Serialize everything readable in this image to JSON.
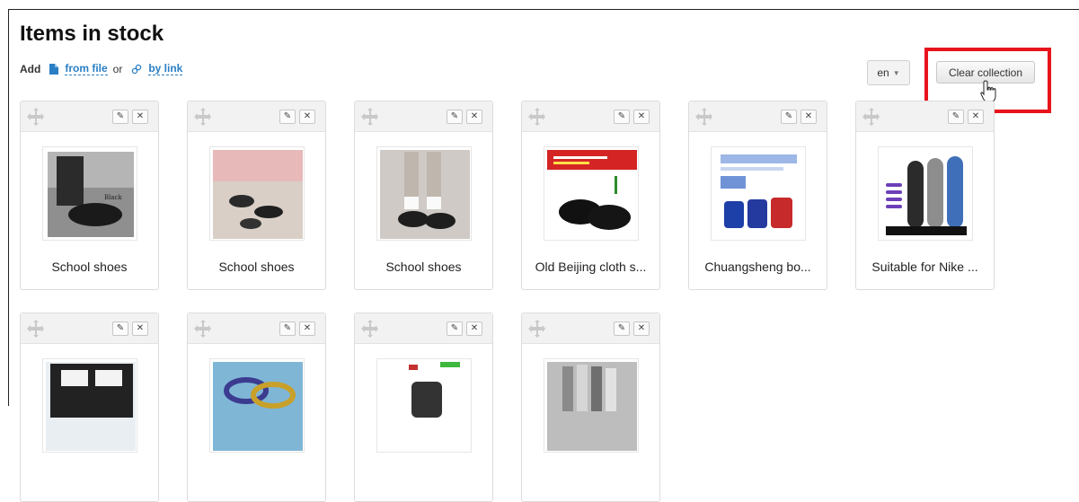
{
  "page": {
    "title": "Items in stock",
    "add_label": "Add",
    "from_file_label": "from file",
    "or_label": "or",
    "by_link_label": "by link"
  },
  "toolbar": {
    "language": "en",
    "clear_label": "Clear collection"
  },
  "items": [
    {
      "caption": "School shoes",
      "image": "black-loafers-photo"
    },
    {
      "caption": "School shoes",
      "image": "shoes-on-floor-photo"
    },
    {
      "caption": "School shoes",
      "image": "loafers-white-socks-photo"
    },
    {
      "caption": "Old Beijing cloth s...",
      "image": "cloth-shoes-photo"
    },
    {
      "caption": "Chuangsheng bo...",
      "image": "bowling-bag-photo"
    },
    {
      "caption": "Suitable for Nike ...",
      "image": "insoles-photo"
    },
    {
      "caption": "",
      "image": "toy-car-photo"
    },
    {
      "caption": "",
      "image": "rings-photo"
    },
    {
      "caption": "",
      "image": "boot-photo"
    },
    {
      "caption": "",
      "image": "socks-photo"
    }
  ],
  "colors": {
    "accent": "#2a7fc4",
    "highlight": "#e8141c"
  }
}
